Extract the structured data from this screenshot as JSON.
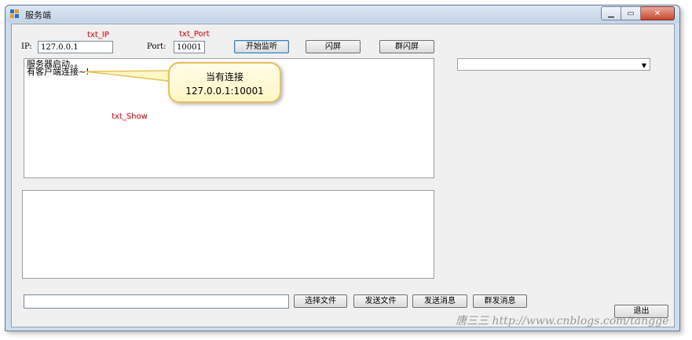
{
  "window": {
    "title": "服务端"
  },
  "connection": {
    "ip_label": "IP:",
    "ip_value": "127.0.0.1",
    "port_label": "Port:",
    "port_value": "10001"
  },
  "buttons": {
    "start_listen": "开始监听",
    "flash_screen": "闪屏",
    "group_flash": "群闪屏",
    "choose_file": "选择文件",
    "send_file": "发送文件",
    "send_message": "发送消息",
    "group_send": "群发消息",
    "exit": "退出"
  },
  "show_log": {
    "line1": "服务器启动。。",
    "line2": "有客户端连接~!"
  },
  "annotations": {
    "txt_ip": "txt_IP",
    "txt_port": "txt_Port",
    "txt_show": "txt_Show"
  },
  "callout": {
    "line1": "当有连接",
    "line2": "127.0.0.1:10001"
  },
  "watermark": "唐三三 http://www.cnblogs.com/tangge",
  "icons": {
    "app": "app-icon",
    "minimize": "minimize-icon",
    "maximize": "maximize-icon",
    "close": "close-icon",
    "dropdown": "chevron-down-icon"
  },
  "colors": {
    "annotation": "#c0202a",
    "callout_border": "#e6c25a",
    "close_button": "#c7462e"
  }
}
